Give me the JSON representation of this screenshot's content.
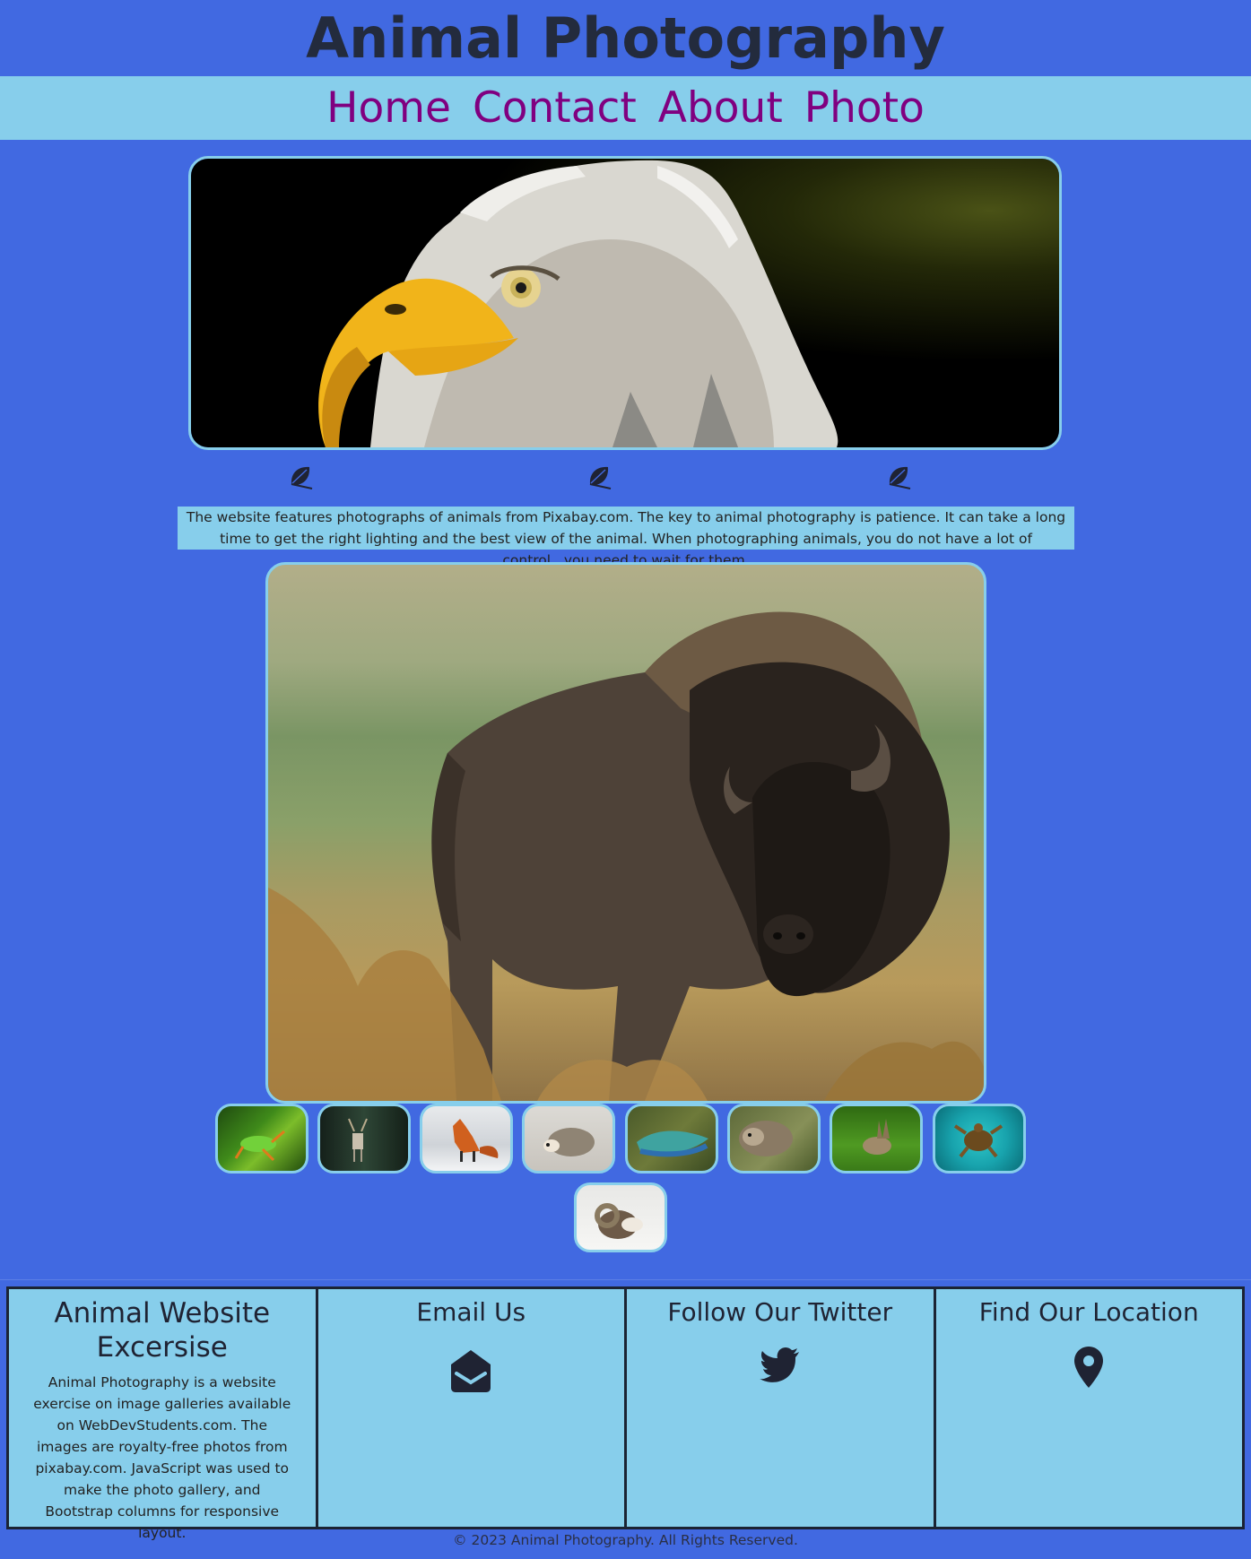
{
  "site": {
    "title": "Animal Photography"
  },
  "nav": {
    "items": [
      "Home",
      "Contact",
      "About",
      "Photo"
    ]
  },
  "intro": {
    "text": "The website features photographs of animals from Pixabay.com. The key to animal photography is patience. It can take a long time to get the right lighting and the best view of the animal. When photographing animals, you do not have a lot of control...you need to wait for them."
  },
  "gallery": {
    "main_photo_subject": "bison",
    "hero_photo_subject": "bald eagle",
    "thumbnails": [
      "frog",
      "deer",
      "fox",
      "hedgehog",
      "lizard",
      "otter",
      "rabbit",
      "sea turtle",
      "bighorn sheep"
    ]
  },
  "footer": {
    "about_title": "Animal Website Excersise",
    "about_text": "Animal Photography is a website exercise on image galleries available on WebDevStudents.com. The images are royalty-free photos from pixabay.com. JavaScript was used to make the photo gallery, and Bootstrap columns for responsive layout.",
    "email_title": "Email Us",
    "twitter_title": "Follow Our Twitter",
    "location_title": "Find Our Location"
  },
  "copyright": "© 2023 Animal Photography. All Rights Reserved.",
  "colors": {
    "background": "#4169e1",
    "nav_bg": "#87ceeb",
    "link": "#800080",
    "border": "#87ceeb"
  }
}
